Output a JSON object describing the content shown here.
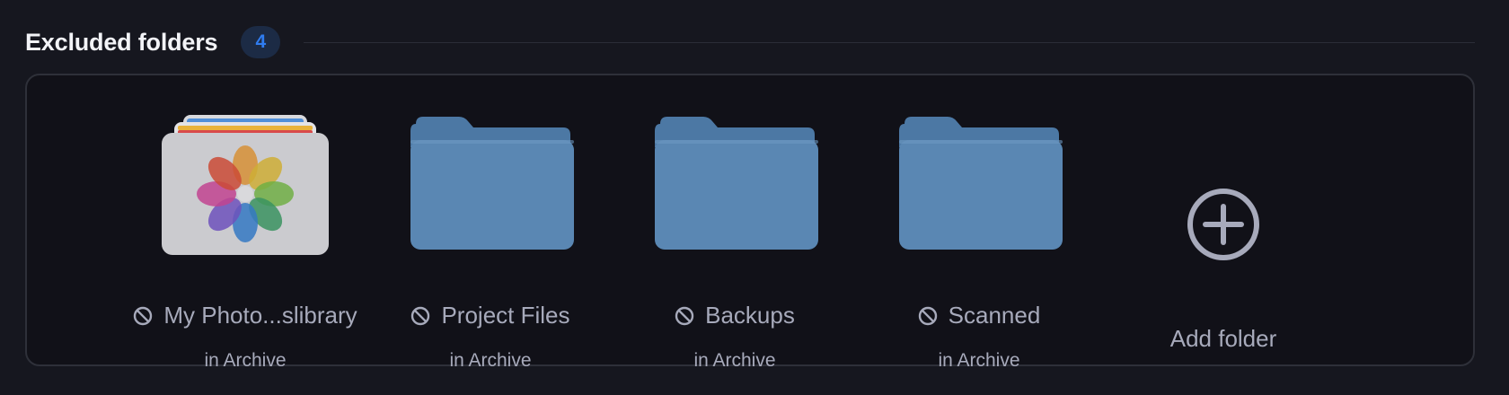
{
  "section": {
    "title": "Excluded folders",
    "count": "4"
  },
  "folders": [
    {
      "name": "My Photo...slibrary",
      "location": "in Archive",
      "icon": "photos-library-icon"
    },
    {
      "name": "Project Files",
      "location": "in Archive",
      "icon": "folder-icon"
    },
    {
      "name": "Backups",
      "location": "in Archive",
      "icon": "folder-icon"
    },
    {
      "name": "Scanned",
      "location": "in Archive",
      "icon": "folder-icon"
    }
  ],
  "add": {
    "label": "Add folder",
    "icon": "plus-circle-icon"
  },
  "colors": {
    "background": "#16171f",
    "panel": "#111118",
    "accent_badge_text": "#2f7cf0",
    "folder_blue": "#5a87b3",
    "muted_text": "#a7aabb"
  }
}
